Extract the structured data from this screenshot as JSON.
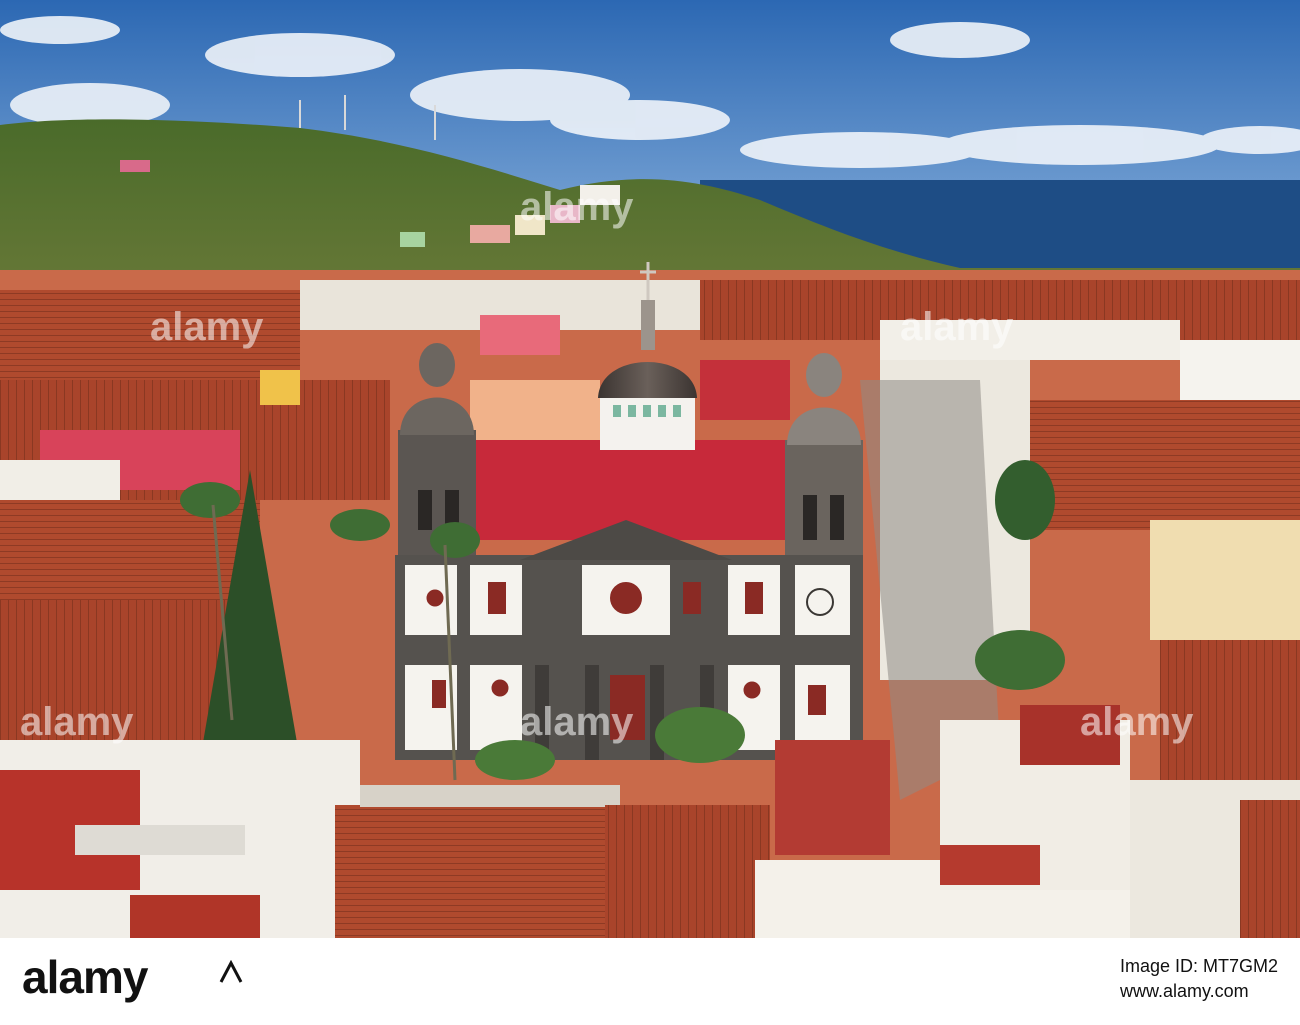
{
  "photo": {
    "subject": "aerial-cathedral-town",
    "colors": {
      "sky_top": "#2f6fb8",
      "sky_bottom": "#8fb7e0",
      "sea": "#1f4f86",
      "hill": "#4f6f2c",
      "roof": "#b24a30",
      "wall": "#f1eee6",
      "stone": "#5a5753",
      "dome": "#4d4540"
    },
    "watermark": "alamy"
  },
  "footer": {
    "brand": "alamy",
    "image_id_label": "Image ID: MT7GM2",
    "url": "www.alamy.com"
  }
}
